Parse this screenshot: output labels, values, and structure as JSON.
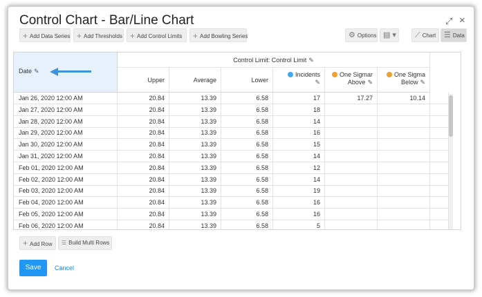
{
  "dialog": {
    "title": "Control Chart - Bar/Line Chart",
    "expand_icon": "expand-icon",
    "close_icon": "close-icon"
  },
  "toolbar": {
    "add_data_series": "Add Data Series",
    "add_thresholds": "Add Thresholds",
    "add_control_limits": "Add Control Limits",
    "add_bowling_series": "Add Bowling Series",
    "options": "Options",
    "chart": "Chart",
    "data": "Data"
  },
  "table": {
    "date_header": "Date",
    "group_header": "Control Limit: Control Limit",
    "columns": [
      "Upper",
      "Average",
      "Lower"
    ],
    "incidents": "Incidents",
    "above_l1": "One Sigmar",
    "above_l2": "Above",
    "below_l1": "One Sigma",
    "below_l2": "Below",
    "colors": {
      "incidents": "#3fa9f5",
      "above": "#f0a030",
      "below": "#f0a030",
      "accent": "#2196f3"
    },
    "rows": [
      [
        "Jan 26, 2020 12:00 AM",
        "20.84",
        "13.39",
        "6.58",
        "17",
        "17.27",
        "10.14"
      ],
      [
        "Jan 27, 2020 12:00 AM",
        "20.84",
        "13.39",
        "6.58",
        "18",
        "",
        ""
      ],
      [
        "Jan 28, 2020 12:00 AM",
        "20.84",
        "13.39",
        "6.58",
        "14",
        "",
        ""
      ],
      [
        "Jan 29, 2020 12:00 AM",
        "20.84",
        "13.39",
        "6.58",
        "16",
        "",
        ""
      ],
      [
        "Jan 30, 2020 12:00 AM",
        "20.84",
        "13.39",
        "6.58",
        "15",
        "",
        ""
      ],
      [
        "Jan 31, 2020 12:00 AM",
        "20.84",
        "13.39",
        "6.58",
        "14",
        "",
        ""
      ],
      [
        "Feb 01, 2020 12:00 AM",
        "20.84",
        "13.39",
        "6.58",
        "12",
        "",
        ""
      ],
      [
        "Feb 02, 2020 12:00 AM",
        "20.84",
        "13.39",
        "6.58",
        "14",
        "",
        ""
      ],
      [
        "Feb 03, 2020 12:00 AM",
        "20.84",
        "13.39",
        "6.58",
        "19",
        "",
        ""
      ],
      [
        "Feb 04, 2020 12:00 AM",
        "20.84",
        "13.39",
        "6.58",
        "16",
        "",
        ""
      ],
      [
        "Feb 05, 2020 12:00 AM",
        "20.84",
        "13.39",
        "6.58",
        "16",
        "",
        ""
      ],
      [
        "Feb 06, 2020 12:00 AM",
        "20.84",
        "13.39",
        "6.58",
        "5",
        "",
        ""
      ]
    ]
  },
  "bottom": {
    "add_row": "Add Row",
    "build_multi_rows": "Build Multi Rows",
    "save": "Save",
    "cancel": "Cancel"
  }
}
